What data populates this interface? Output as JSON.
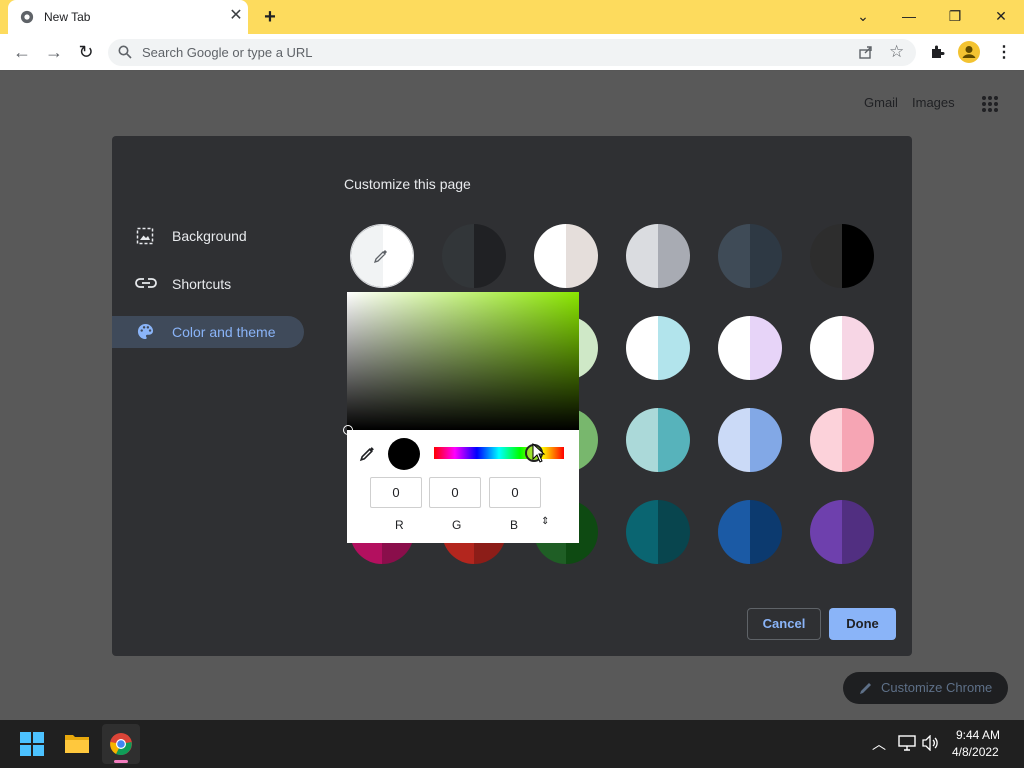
{
  "browser": {
    "tab_title": "New Tab",
    "omnibox_placeholder": "Search Google or type a URL"
  },
  "newtab": {
    "links": [
      "Gmail",
      "Images"
    ],
    "customize_chrome_label": "Customize Chrome"
  },
  "dialog": {
    "title": "Customize this page",
    "sidebar": [
      {
        "label": "Background",
        "icon": "image-icon",
        "active": false
      },
      {
        "label": "Shortcuts",
        "icon": "link-icon",
        "active": false
      },
      {
        "label": "Color and theme",
        "icon": "palette-icon",
        "active": true
      }
    ],
    "cancel_label": "Cancel",
    "done_label": "Done",
    "swatches": [
      {
        "left": "#f1f3f4",
        "right": "#ffffff"
      },
      {
        "left": "#323639",
        "right": "#202124"
      },
      {
        "left": "#ffffff",
        "right": "#e5dedb"
      },
      {
        "left": "#dadce0",
        "right": "#a8abb3"
      },
      {
        "left": "#3f4b57",
        "right": "#2e3944"
      },
      {
        "left": "#2d2d2d",
        "right": "#000000"
      },
      {
        "left": "#ffffff",
        "right": "#cfe8c7"
      },
      {
        "left": "#ffffff",
        "right": "#b2e4ec"
      },
      {
        "left": "#ffffff",
        "right": "#e7d4f8"
      },
      {
        "left": "#ffffff",
        "right": "#f7d6e5"
      },
      {
        "left": "#b7ddb0",
        "right": "#78b76d"
      },
      {
        "left": "#abd9d9",
        "right": "#57b3bb"
      },
      {
        "left": "#cbdaf7",
        "right": "#82a8e6"
      },
      {
        "left": "#fcd2da",
        "right": "#f6a5b4"
      },
      {
        "left": "#b3105f",
        "right": "#8a0e4b"
      },
      {
        "left": "#b3261e",
        "right": "#8c1d18"
      },
      {
        "left": "#1f5e25",
        "right": "#0e4a12"
      },
      {
        "left": "#0a6571",
        "right": "#08454e"
      },
      {
        "left": "#1b5aa5",
        "right": "#0c3a6f"
      },
      {
        "left": "#6e40ad",
        "right": "#512f81"
      }
    ]
  },
  "color_picker": {
    "r": "0",
    "g": "0",
    "b": "0",
    "r_label": "R",
    "g_label": "G",
    "b_label": "B",
    "hue_position": 0.77
  },
  "taskbar": {
    "time": "9:44 AM",
    "date": "4/8/2022"
  }
}
